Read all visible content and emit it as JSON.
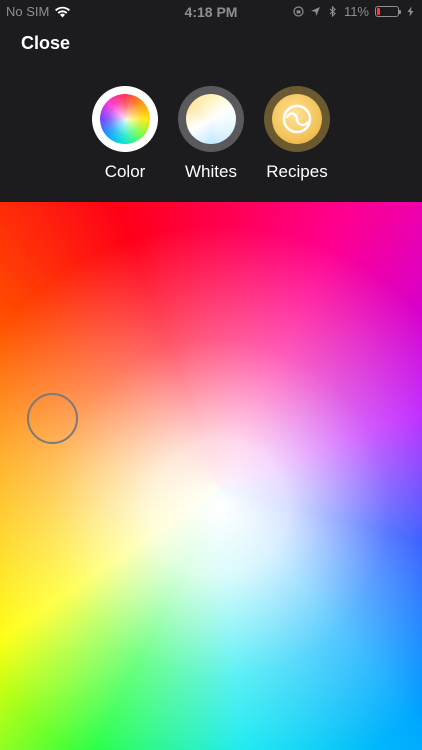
{
  "status_bar": {
    "carrier": "No SIM",
    "time": "4:18 PM",
    "battery_percent": "11%"
  },
  "header": {
    "close_label": "Close"
  },
  "mode_tabs": [
    {
      "label": "Color",
      "icon": "color-wheel-icon",
      "selected": true
    },
    {
      "label": "Whites",
      "icon": "white-wheel-icon",
      "selected": false
    },
    {
      "label": "Recipes",
      "icon": "recipe-icon",
      "selected": false
    }
  ],
  "colors": {
    "header_background": "#1c1c1e",
    "text": "#ffffff",
    "battery_low": "#ff3b30"
  }
}
